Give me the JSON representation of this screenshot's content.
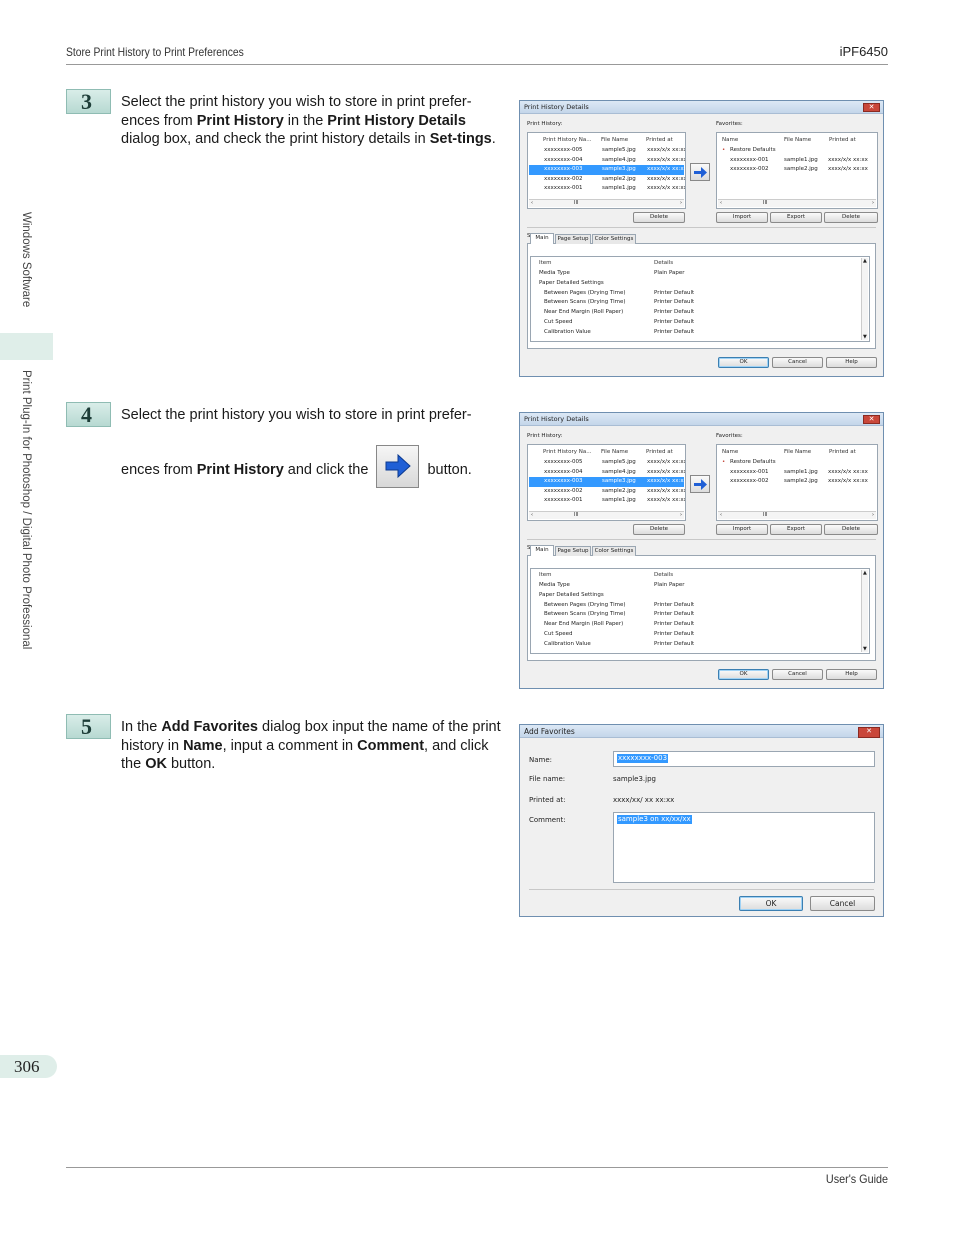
{
  "header": {
    "left": "Store Print History to Print Preferences",
    "right": "iPF6450"
  },
  "sidebar": {
    "section1": "Windows Software",
    "section2": "Print Plug-In for Photoshop / Digital Photo Professional"
  },
  "steps": [
    {
      "num": "3",
      "parts": [
        "Select the print history you wish to store in print prefer-ences from ",
        "Print History",
        " in the ",
        "Print History Details",
        " dialog box, and check the print history details in ",
        "Set-tings",
        "."
      ]
    },
    {
      "num": "4",
      "parts_line1": "Select the print history you wish to store in print prefer-",
      "parts": [
        "ences from ",
        "Print History",
        " and click the ",
        " button."
      ]
    },
    {
      "num": "5",
      "parts": [
        "In the ",
        "Add Favorites",
        " dialog box input the name of the print history in ",
        "Name",
        ", input a comment in ",
        "Comment",
        ", and click the ",
        "OK",
        " button."
      ]
    }
  ],
  "details_dialog": {
    "title": "Print History Details",
    "close": "✕",
    "print_history_label": "Print History:",
    "favorites_label": "Favorites:",
    "history_columns": [
      "Print History Na...",
      "File Name",
      "Printed at"
    ],
    "history_rows": [
      [
        "xxxxxxxx-005",
        "sample5.jpg",
        "xxxx/x/x xx:xx"
      ],
      [
        "xxxxxxxx-004",
        "sample4.jpg",
        "xxxx/x/x xx:xx"
      ],
      [
        "xxxxxxxx-003",
        "sample3.jpg",
        "xxxx/x/x xx:xx"
      ],
      [
        "xxxxxxxx-002",
        "sample2.jpg",
        "xxxx/x/x xx:xx"
      ],
      [
        "xxxxxxxx-001",
        "sample1.jpg",
        "xxxx/x/x xx:xx"
      ]
    ],
    "favorites_columns": [
      "Name",
      "File Name",
      "Printed at"
    ],
    "favorites_rows": [
      [
        "Restore Defaults",
        "",
        ""
      ],
      [
        "xxxxxxxx-001",
        "sample1.jpg",
        "xxxx/x/x xx:xx"
      ],
      [
        "xxxxxxxx-002",
        "sample2.jpg",
        "xxxx/x/x xx:xx"
      ]
    ],
    "scroll_mark": "III",
    "delete_label": "Delete",
    "import_label": "Import",
    "export_label": "Export",
    "settings_label": "Settings:",
    "tabs": [
      "Main",
      "Page Setup",
      "Color Settings"
    ],
    "settings_columns": [
      "Item",
      "Details"
    ],
    "settings_rows": [
      [
        "Media Type",
        "Plain Paper"
      ],
      [
        "Paper Detailed Settings",
        ""
      ],
      [
        "Between Pages (Drying Time)",
        "Printer Default"
      ],
      [
        "Between Scans (Drying Time)",
        "Printer Default"
      ],
      [
        "Near End Margin (Roll Paper)",
        "Printer Default"
      ],
      [
        "Cut Speed",
        "Printer Default"
      ],
      [
        "Calibration Value",
        "Printer Default"
      ]
    ],
    "ok_label": "OK",
    "cancel_label": "Cancel",
    "help_label": "Help"
  },
  "add_favorites": {
    "title": "Add Favorites",
    "close": "✕",
    "name_label": "Name:",
    "name_value": "xxxxxxxx-003",
    "filename_label": "File name:",
    "filename_value": "sample3.jpg",
    "printed_label": "Printed at:",
    "printed_value": "xxxx/xx/ xx xx:xx",
    "comment_label": "Comment:",
    "comment_value": "sample3 on xx/xx/xx",
    "ok_label": "OK",
    "cancel_label": "Cancel"
  },
  "footer": {
    "page": "306",
    "right": "User's Guide"
  },
  "colors": {
    "accent": "#dfeee9",
    "selection": "#3399ff",
    "arrow": "#1f5fd6"
  }
}
